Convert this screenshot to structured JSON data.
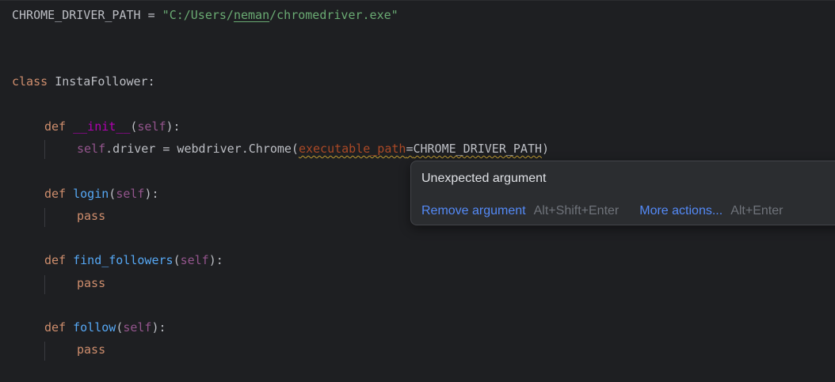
{
  "code": {
    "line1": {
      "const": "CHROME_DRIVER_PATH",
      "eq": " = ",
      "q1": "\"",
      "path_a": "C:/Users/",
      "path_user": "neman",
      "path_b": "/chromedriver.exe",
      "q2": "\""
    },
    "line2": {
      "kw": "class ",
      "name": "InstaFollower",
      "colon": ":"
    },
    "line3": {
      "kw": "def ",
      "name": "__init__",
      "open": "(",
      "self": "self",
      "close": "):"
    },
    "line4": {
      "self": "self",
      "rest": ".driver = webdriver.Chrome(",
      "param": "executable_path",
      "eq": "=",
      "value": "CHROME_DRIVER_PATH",
      "close": ")"
    },
    "line5": {
      "kw": "def ",
      "name": "login",
      "open": "(",
      "self": "self",
      "close": "):"
    },
    "line6": {
      "kw": "pass"
    },
    "line7": {
      "kw": "def ",
      "name": "find_followers",
      "open": "(",
      "self": "self",
      "close": "):"
    },
    "line8": {
      "kw": "pass"
    },
    "line9": {
      "kw": "def ",
      "name": "follow",
      "open": "(",
      "self": "self",
      "close": "):"
    },
    "line10": {
      "kw": "pass"
    }
  },
  "tooltip": {
    "title": "Unexpected argument",
    "primary_action": "Remove argument",
    "primary_shortcut": "Alt+Shift+Enter",
    "secondary_action": "More actions...",
    "secondary_shortcut": "Alt+Enter",
    "menu_glyph": "⋮"
  },
  "colors": {
    "background": "#1e1f22",
    "keyword": "#cf8e6d",
    "function": "#56a8f5",
    "string": "#6aab73",
    "self": "#94558d",
    "param": "#aa4926",
    "link": "#548af7"
  }
}
